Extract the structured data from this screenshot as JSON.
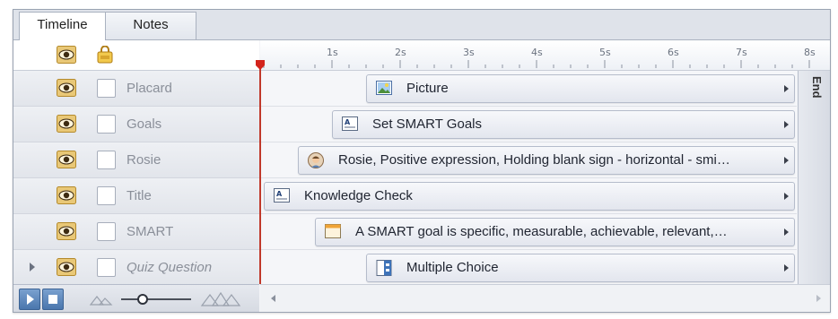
{
  "tabs": [
    {
      "label": "Timeline",
      "active": true
    },
    {
      "label": "Notes",
      "active": false
    }
  ],
  "ruler": {
    "labels": [
      "1s",
      "2s",
      "3s",
      "4s",
      "5s",
      "6s",
      "7s",
      "8s"
    ]
  },
  "end_label": "End",
  "rows": [
    {
      "name": "Placard",
      "italic": false,
      "expandable": false,
      "bar_label": "Picture",
      "bar_icon": "picture-icon",
      "start_s": 1.5
    },
    {
      "name": "Goals",
      "italic": false,
      "expandable": false,
      "bar_label": "Set SMART Goals",
      "bar_icon": "text-caption-icon",
      "start_s": 1.0
    },
    {
      "name": "Rosie",
      "italic": false,
      "expandable": false,
      "bar_label": "Rosie, Positive expression, Holding blank sign - horizontal - smi…",
      "bar_icon": "character-icon",
      "start_s": 0.5
    },
    {
      "name": "Title",
      "italic": false,
      "expandable": false,
      "bar_label": "Knowledge Check",
      "bar_icon": "text-caption-icon",
      "start_s": 0.0
    },
    {
      "name": "SMART",
      "italic": false,
      "expandable": false,
      "bar_label": "A SMART goal is specific, measurable, achievable, relevant,…",
      "bar_icon": "shape-icon",
      "start_s": 0.75
    },
    {
      "name": "Quiz Question",
      "italic": true,
      "expandable": true,
      "bar_label": "Multiple Choice",
      "bar_icon": "quiz-icon",
      "start_s": 1.5
    }
  ],
  "colors": {
    "playhead": "#d3241c",
    "play_button": "#4a76ad"
  }
}
